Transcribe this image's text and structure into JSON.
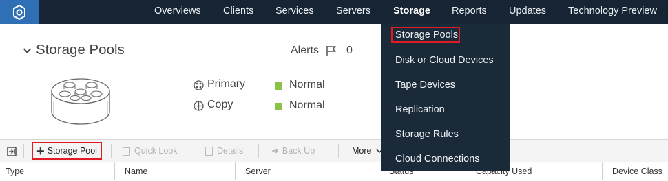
{
  "nav": {
    "items": [
      "Overviews",
      "Clients",
      "Services",
      "Servers",
      "Storage",
      "Reports",
      "Updates",
      "Technology Preview"
    ],
    "active": "Storage"
  },
  "dropdown": {
    "items": [
      "Storage Pools",
      "Disk or Cloud Devices",
      "Tape Devices",
      "Replication",
      "Storage Rules",
      "Cloud Connections"
    ],
    "highlighted": "Storage Pools"
  },
  "page": {
    "title": "Storage Pools",
    "alerts_label": "Alerts",
    "alerts_count": "0"
  },
  "summary": {
    "rows": [
      {
        "label": "Primary",
        "status": "Normal"
      },
      {
        "label": "Copy",
        "status": "Normal"
      }
    ]
  },
  "toolbar": {
    "add_label": "Storage Pool",
    "quick_look": "Quick Look",
    "details": "Details",
    "back_up": "Back Up",
    "more": "More"
  },
  "table": {
    "columns": [
      "Type",
      "Name",
      "Server",
      "Status",
      "Capacity Used",
      "Device Class"
    ]
  },
  "colors": {
    "topbar": "#162433",
    "logo_bg": "#2f6fb6",
    "highlight_red": "#e01b24",
    "status_green": "#8bc34a"
  }
}
